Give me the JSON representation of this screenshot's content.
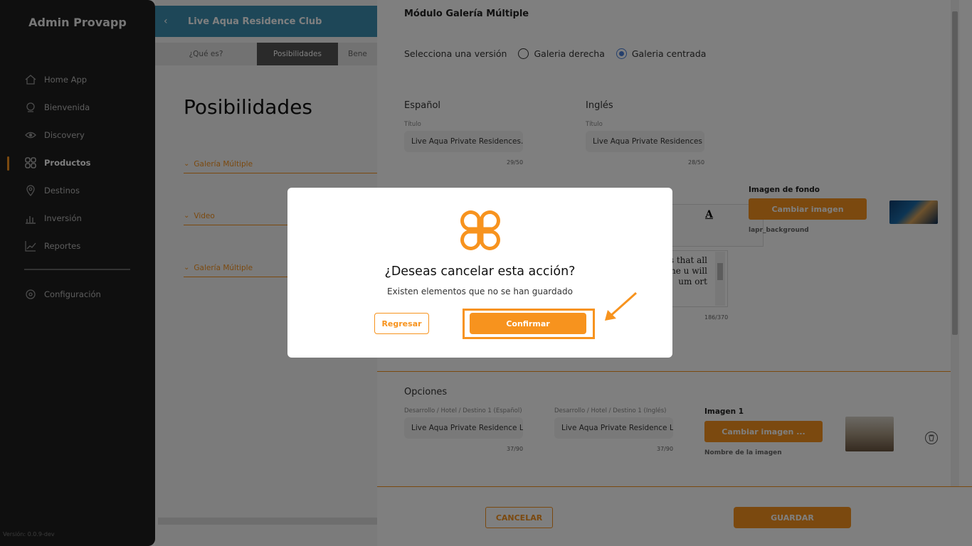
{
  "sidebar": {
    "brand": "Admin Provapp",
    "items": [
      {
        "label": "Home App",
        "icon": "home-icon"
      },
      {
        "label": "Bienvenida",
        "icon": "welcome-icon"
      },
      {
        "label": "Discovery",
        "icon": "eye-icon"
      },
      {
        "label": "Productos",
        "icon": "grid-icon",
        "active": true
      },
      {
        "label": "Destinos",
        "icon": "location-pin-icon"
      },
      {
        "label": "Inversión",
        "icon": "bar-chart-icon"
      },
      {
        "label": "Reportes",
        "icon": "line-chart-icon"
      }
    ],
    "settings_label": "Configuración",
    "version": "Versión: 0.0.9-dev"
  },
  "main": {
    "header_title": "Live Aqua Residence Club",
    "tabs": [
      "¿Qué es?",
      "Posibilidades",
      "Bene"
    ],
    "active_tab": "Posibilidades",
    "page_title": "Posibilidades",
    "accordions": [
      "Galería Múltiple",
      "Video",
      "Galería Múltiple"
    ]
  },
  "panel": {
    "title": "Módulo Galería Múltiple",
    "version_label": "Selecciona una versión",
    "option_right": "Galeria derecha",
    "option_center": "Galeria centrada",
    "selected_option": "Galeria centrada",
    "lang_es": "Español",
    "lang_en": "Inglés",
    "title_label": "Título",
    "title_es_value": "Live Aqua Private Residences.",
    "title_en_value": "Live Aqua Private Residences",
    "title_es_count": "29/50",
    "title_en_count": "28/50",
    "rte_toolbar_glyph": "A",
    "rte_text": "ces that all the u will um ort",
    "rte_count": "186/370",
    "bg_label": "Imagen de fondo",
    "bg_button": "Cambiar imagen",
    "bg_filename": "lapr_background",
    "options_label": "Opciones",
    "dest_es_label": "Desarrollo / Hotel / Destino 1 (Español)",
    "dest_en_label": "Desarrollo / Hotel / Destino 1 (Inglés)",
    "dest_es_value": "Live Aqua Private Residence Lo",
    "dest_en_value": "Live Aqua Private Residence Lo",
    "dest_es_count": "37/90",
    "dest_en_count": "37/90",
    "img1_label": "Imagen 1",
    "img1_button": "Cambiar imagen ...",
    "img1_name_label": "Nombre de la imagen",
    "cancel_label": "CANCELAR",
    "save_label": "GUARDAR"
  },
  "modal": {
    "title": "¿Deseas cancelar esta acción?",
    "message": "Existen elementos que no se han guardado",
    "back_label": "Regresar",
    "confirm_label": "Confirmar"
  },
  "colors": {
    "accent": "#F7931E",
    "sidebar_bg": "#1e1e1e",
    "header_blue": "#3d8fb0",
    "radio_selected": "#4a7fd9"
  }
}
